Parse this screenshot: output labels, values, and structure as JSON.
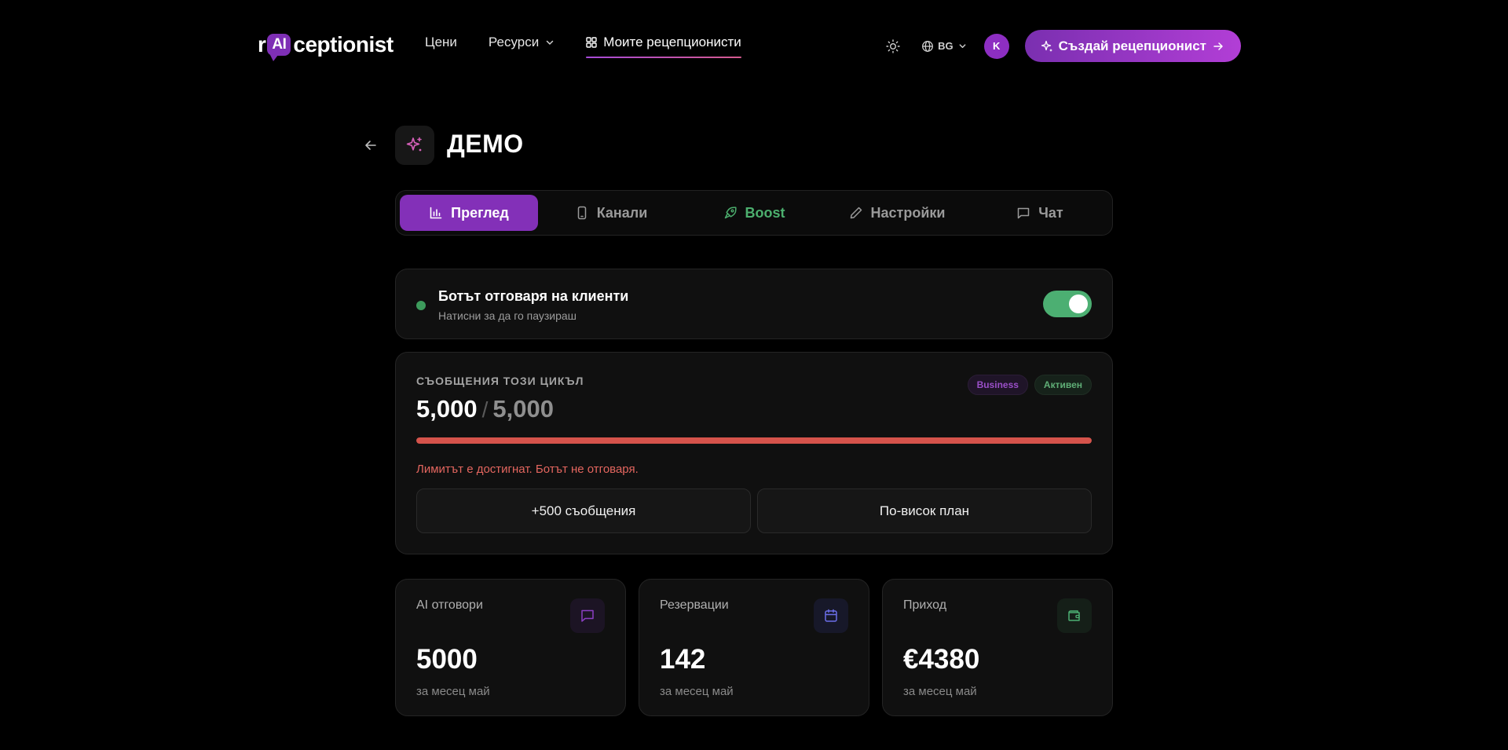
{
  "header": {
    "logo": {
      "prefix": "r",
      "ai": "AI",
      "suffix": "ceptionist"
    },
    "nav": {
      "prices": "Цени",
      "resources": "Ресурси",
      "my_receptionists": "Моите рецепционисти"
    },
    "language": "BG",
    "avatar_initial": "K",
    "cta_label": "Създай рецепционист"
  },
  "page": {
    "title": "ДЕМО"
  },
  "tabs": [
    {
      "label": "Преглед",
      "icon": "bar-chart-icon",
      "active": true
    },
    {
      "label": "Канали",
      "icon": "phone-icon",
      "active": false
    },
    {
      "label": "Boost",
      "icon": "rocket-icon",
      "active": false
    },
    {
      "label": "Настройки",
      "icon": "pencil-icon",
      "active": false
    },
    {
      "label": "Чат",
      "icon": "chat-icon",
      "active": false
    }
  ],
  "bot_status": {
    "title": "Ботът отговаря на клиенти",
    "subtitle": "Натисни за да го паузираш",
    "enabled": true
  },
  "messages": {
    "label": "СЪОБЩЕНИЯ ТОЗИ ЦИКЪЛ",
    "used": "5,000",
    "separator": "/",
    "limit": "5,000",
    "usage_fraction": 1.0,
    "plan_badge": "Business",
    "status_badge": "Активен",
    "warning": "Лимитът е достигнат. Ботът не отговаря.",
    "buy_more_label": "+500 съобщения",
    "upgrade_label": "По-висок план"
  },
  "stats": [
    {
      "label": "AI отговори",
      "value": "5000",
      "sub": "за месец май",
      "icon": "message-square-icon",
      "color": "#8b3fc4"
    },
    {
      "label": "Резервации",
      "value": "142",
      "sub": "за месец май",
      "icon": "calendar-icon",
      "color": "#6b6ee8"
    },
    {
      "label": "Приход",
      "value": "€4380",
      "sub": "за месец май",
      "icon": "wallet-icon",
      "color": "#4caf72"
    }
  ],
  "colors": {
    "accent": "#8330b8",
    "success": "#4caf72",
    "danger": "#d5534b"
  }
}
